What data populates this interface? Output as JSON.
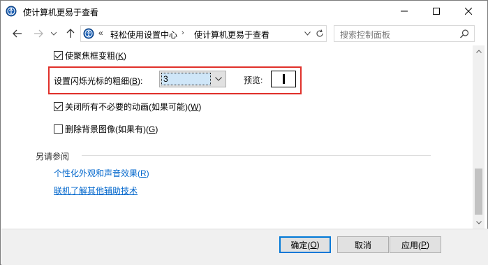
{
  "window": {
    "title": "使计算机更易于查看"
  },
  "address": {
    "prefix": "«",
    "crumbs": [
      "轻松使用设置中心",
      "使计算机更易于查看"
    ]
  },
  "search": {
    "placeholder": "搜索控制面板"
  },
  "options": {
    "focus_border": {
      "label": "使聚焦框变粗(",
      "key": "K",
      "suffix": ")",
      "checked": true
    },
    "cursor_thickness": {
      "label": "设置闪烁光标的粗细(",
      "key": "B",
      "suffix": "):",
      "value": "3"
    },
    "preview_label": "预览:",
    "animations": {
      "label": "关闭所有不必要的动画(如果可能)(",
      "key": "W",
      "suffix": ")",
      "checked": true
    },
    "background": {
      "label": "删除背景图像(如果有)(",
      "key": "G",
      "suffix": ")",
      "checked": false
    }
  },
  "see_also": {
    "title": "另请参阅",
    "link1": {
      "label": "个性化外观和声音效果(",
      "key": "R",
      "suffix": ")"
    },
    "link2": "联机了解其他辅助技术"
  },
  "footer": {
    "ok": {
      "label": "确定(",
      "key": "O",
      "suffix": ")"
    },
    "cancel": "取消",
    "apply": {
      "label": "应用(",
      "key": "P",
      "suffix": ")"
    }
  },
  "colors": {
    "highlight": "#e0302a",
    "link": "#0066cc",
    "accent": "#0078d7"
  }
}
